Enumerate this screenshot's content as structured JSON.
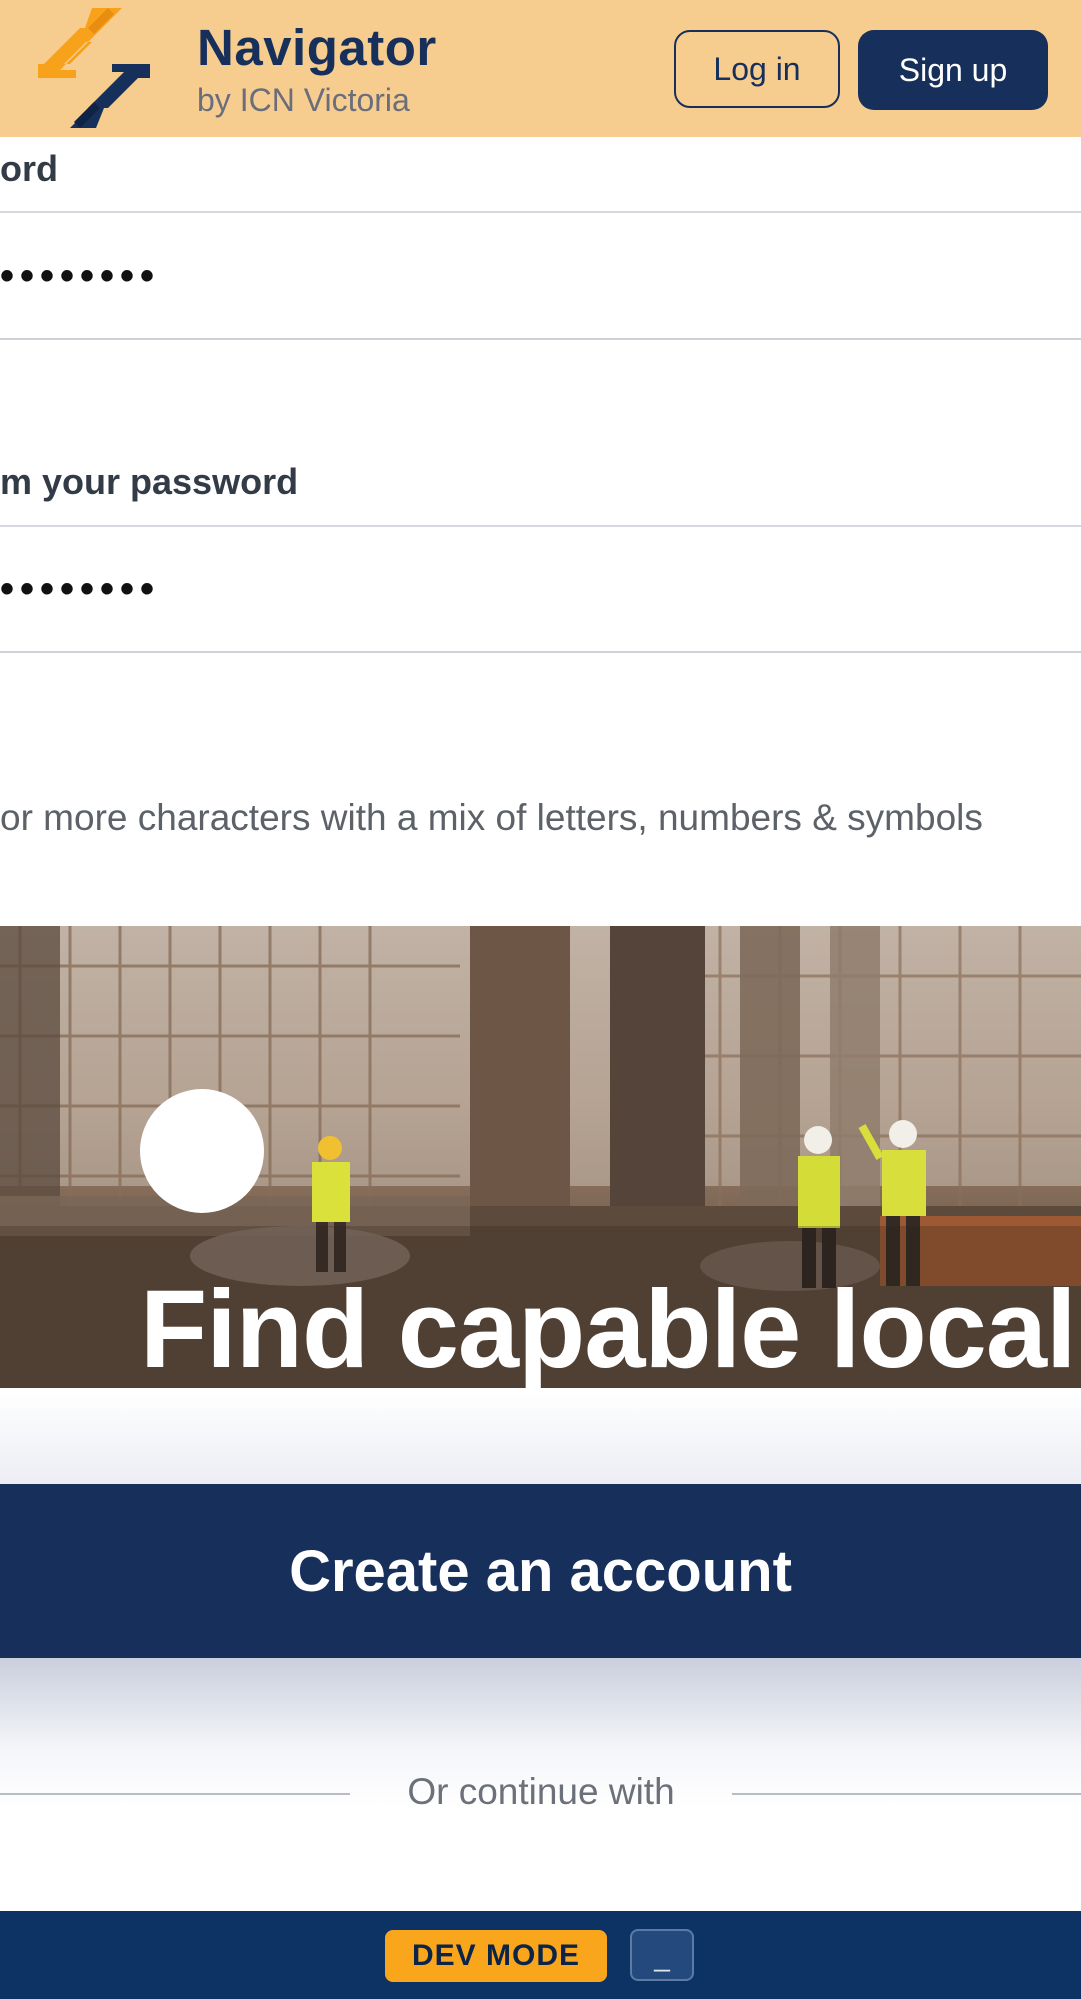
{
  "header": {
    "brand_title": "Navigator",
    "brand_subtitle": "by ICN Victoria",
    "login_label": "Log in",
    "signup_label": "Sign up"
  },
  "form": {
    "password_label": "ord",
    "password_value": "••••••••",
    "confirm_label": "m your password",
    "confirm_value": "••••••••",
    "hint": "or more characters with a mix of letters, numbers & symbols"
  },
  "hero": {
    "headline": "Find capable local"
  },
  "actions": {
    "create_account_label": "Create an account",
    "or_continue": "Or continue with"
  },
  "devbar": {
    "badge": "DEV MODE",
    "minimize": "_"
  },
  "colors": {
    "header_bg": "#f7cc8f",
    "brand_navy": "#17305b",
    "accent_orange": "#f9a61d",
    "devbar_bg": "#0c3364"
  }
}
